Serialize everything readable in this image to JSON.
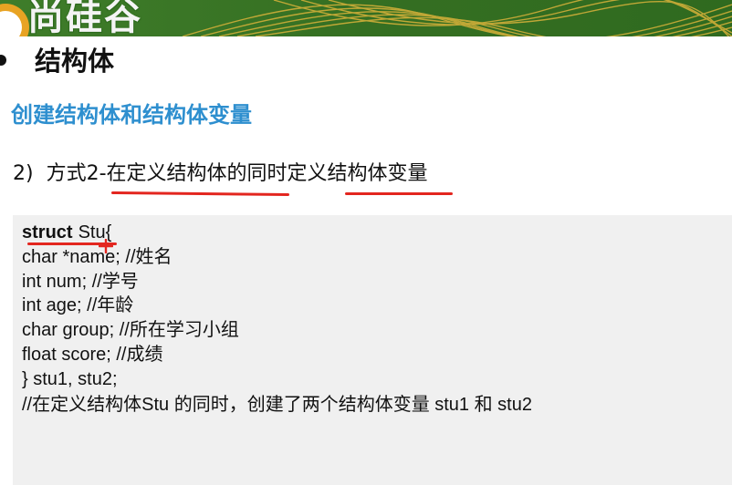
{
  "banner": {
    "logo_text": "尚硅谷",
    "colors": {
      "green": "#3a7a25",
      "gold": "#d9b23a"
    }
  },
  "slide": {
    "heading": "结构体",
    "subheading": "创建结构体和结构体变量",
    "method_number": "2)",
    "method_text": "方式2-在定义结构体的同时定义结构体变量"
  },
  "code": {
    "keyword": "struct",
    "struct_head_rest": "Stu{",
    "lines": [
      "char *name; //姓名",
      "int num; //学号",
      "int age; //年龄",
      "char group; //所在学习小组",
      "float score; //成绩",
      "} stu1, stu2;",
      "//在定义结构体Stu 的同时，创建了两个结构体变量 stu1 和 stu2"
    ]
  },
  "colors": {
    "heading_blue": "#2e8fcf",
    "annotation_red": "#e3261f",
    "code_bg": "#f0f0f0"
  }
}
